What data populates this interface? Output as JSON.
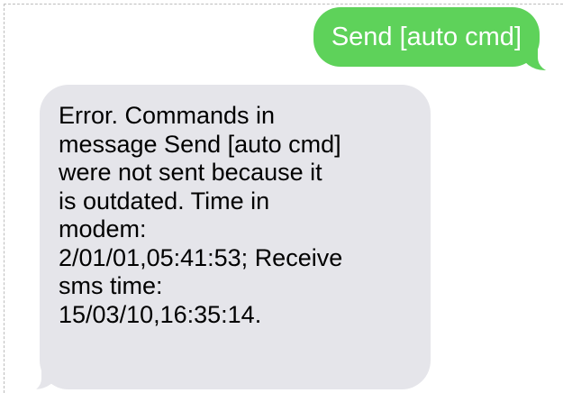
{
  "conversation": {
    "messages": [
      {
        "direction": "outgoing",
        "text": "Send [auto cmd]",
        "bubble_color": "#5ed25a"
      },
      {
        "direction": "incoming",
        "bubble_color": "#e5e5ea",
        "lines": [
          "Error. Commands in",
          "message Send [auto cmd]",
          "were not sent because it",
          "is outdated. Time in",
          "modem:",
          "2/01/01,05:41:53; Receive",
          "sms time:",
          "15/03/10,16:35:14."
        ]
      }
    ]
  }
}
